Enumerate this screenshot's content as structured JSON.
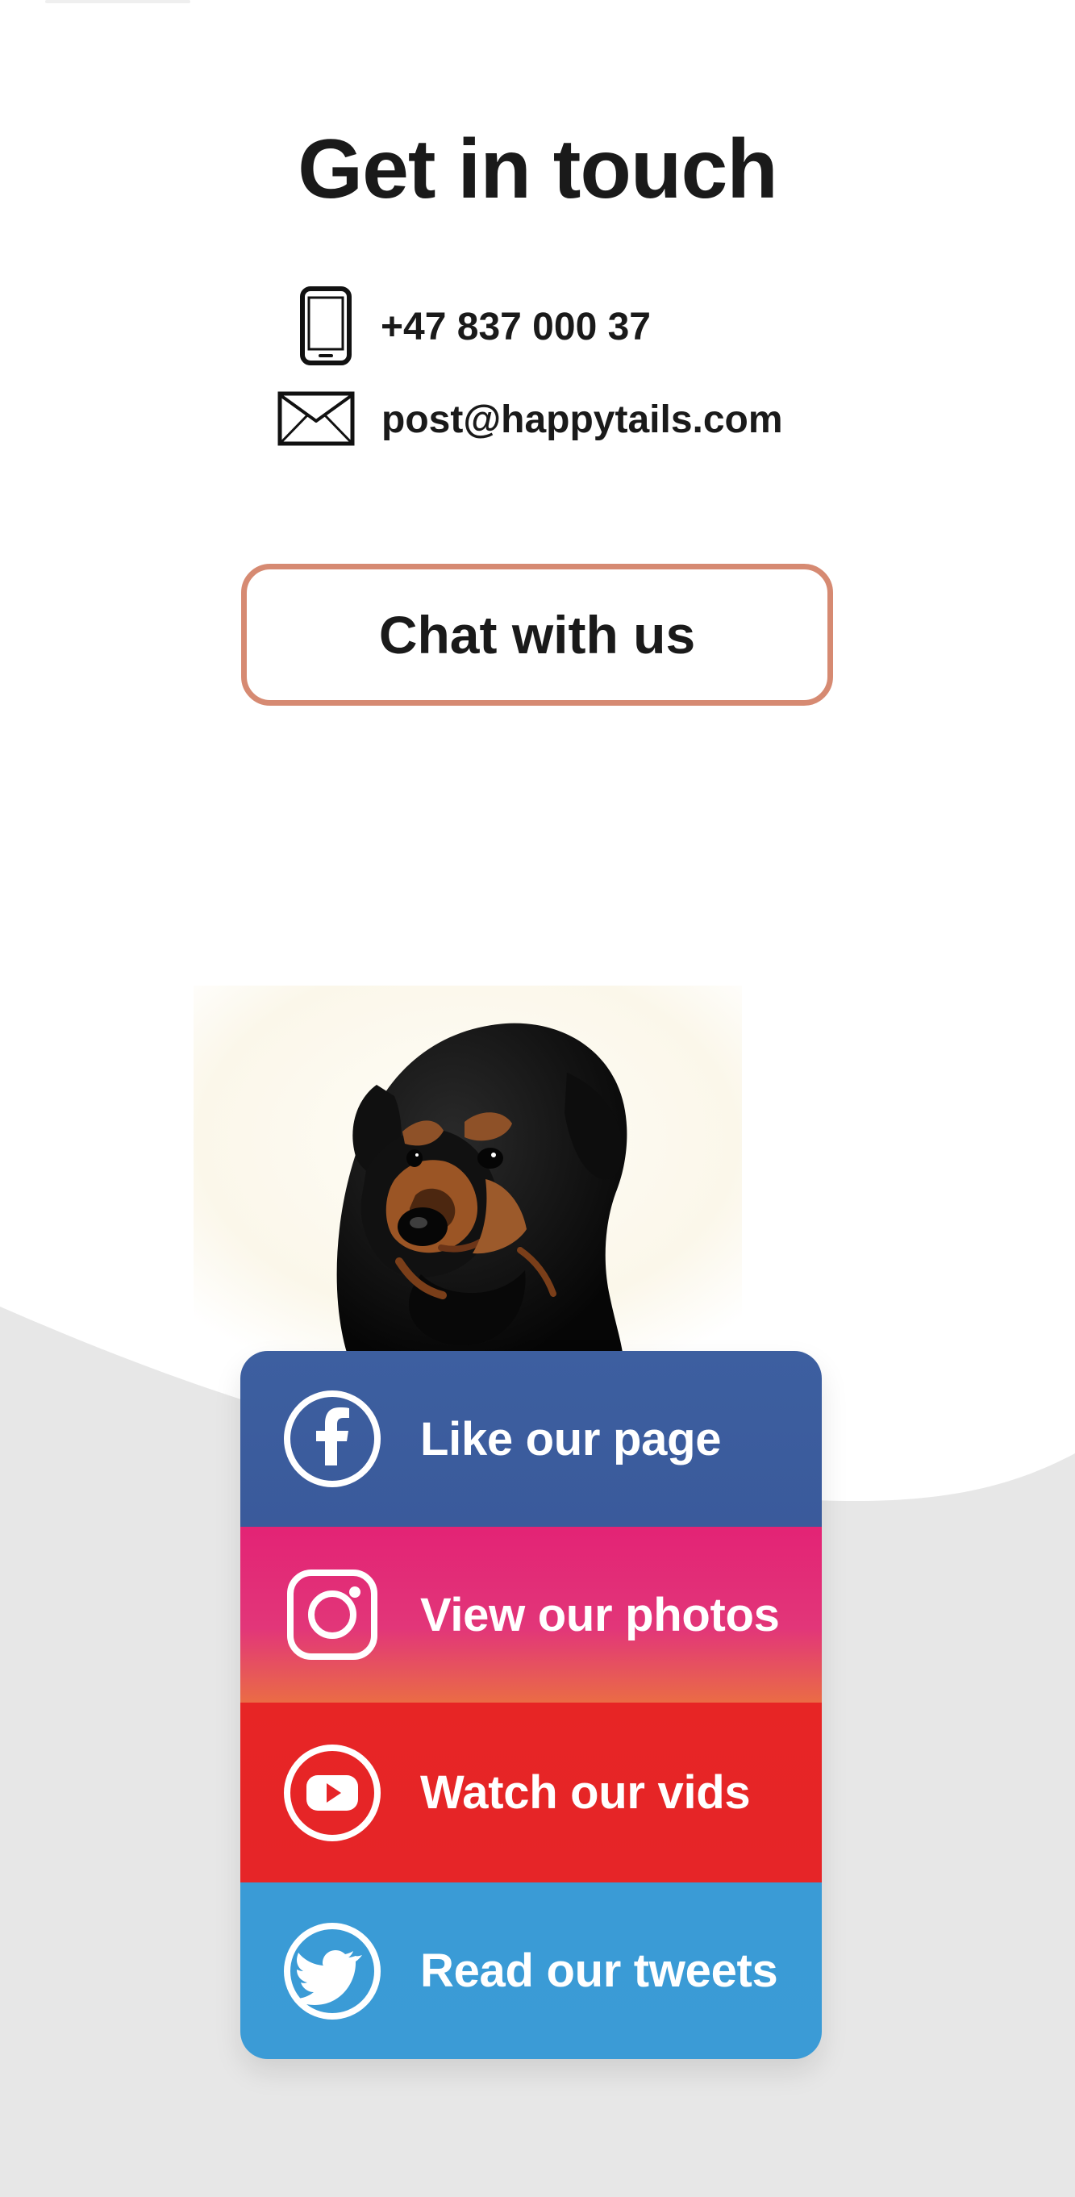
{
  "header": {
    "title": "Get in touch"
  },
  "contact": {
    "phone": "+47 837 000 37",
    "email": "post@happytails.com"
  },
  "actions": {
    "chat_label": "Chat with us"
  },
  "social": {
    "items": [
      {
        "label": "Like our page",
        "icon": "facebook-icon",
        "color": "#3b5a9b"
      },
      {
        "label": "View our photos",
        "icon": "instagram-icon",
        "color": "#e23679"
      },
      {
        "label": "Watch our vids",
        "icon": "youtube-icon",
        "color": "#e62528"
      },
      {
        "label": "Read our tweets",
        "icon": "twitter-icon",
        "color": "#3b9bd6"
      }
    ]
  },
  "theme": {
    "accent": "#d68a72",
    "background": "#ffffff",
    "bottom_background": "#e7e7e7"
  }
}
